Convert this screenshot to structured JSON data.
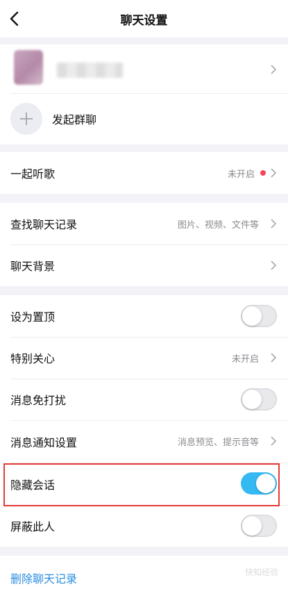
{
  "nav": {
    "title": "聊天设置"
  },
  "members": {
    "start_group_label": "发起群聊"
  },
  "listen_together": {
    "label": "一起听歌",
    "status": "未开启"
  },
  "history": {
    "search_label": "查找聊天记录",
    "search_sub": "图片、视频、文件等",
    "background_label": "聊天背景"
  },
  "settings": [
    {
      "label": "设为置顶",
      "type": "toggle",
      "on": false
    },
    {
      "label": "特别关心",
      "type": "link",
      "sub": "未开启"
    },
    {
      "label": "消息免打扰",
      "type": "toggle",
      "on": false
    },
    {
      "label": "消息通知设置",
      "type": "link",
      "sub": "消息预览、提示音等"
    },
    {
      "label": "隐藏会话",
      "type": "toggle",
      "on": true
    },
    {
      "label": "屏蔽此人",
      "type": "toggle",
      "on": false
    }
  ],
  "delete_label": "删除聊天记录",
  "watermark": "快知经验",
  "colors": {
    "toggle_on": "#34b9f2",
    "red_dot": "#f2455b",
    "link_blue": "#2b8de0",
    "highlight": "#e53935"
  }
}
